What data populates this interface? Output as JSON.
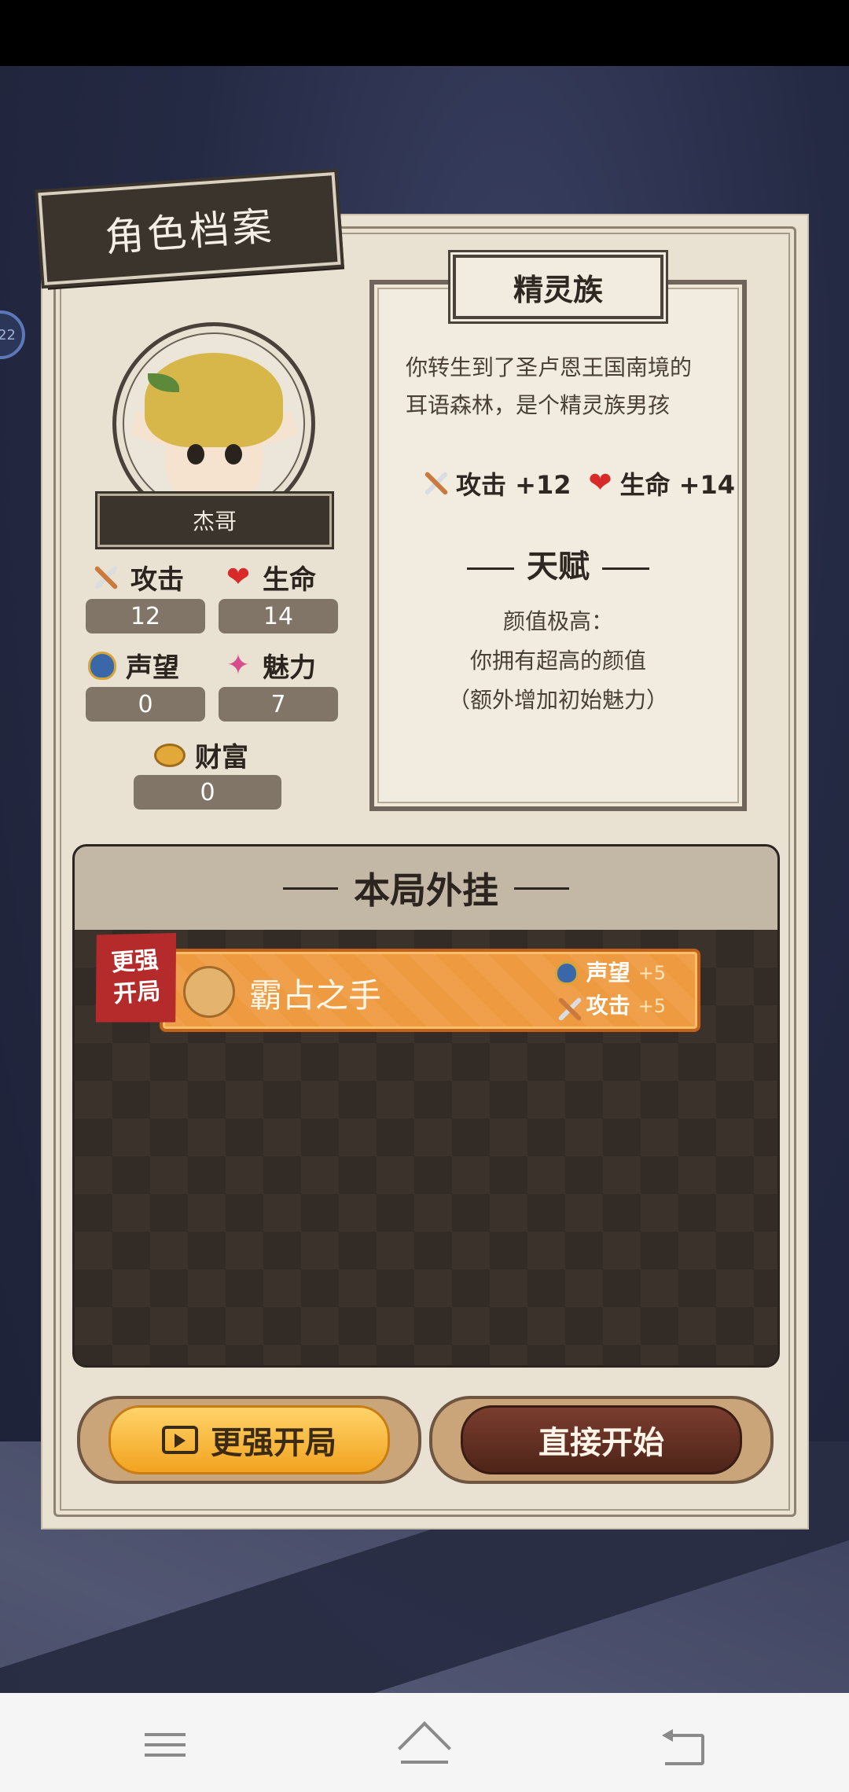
{
  "header": {
    "title": "角色档案"
  },
  "side_bubble": {
    "text": "22"
  },
  "character": {
    "name": "杰哥",
    "stats": {
      "attack": {
        "label": "攻击",
        "value": "12",
        "icon": "crossed-swords-icon"
      },
      "life": {
        "label": "生命",
        "value": "14",
        "icon": "heart-icon"
      },
      "reputation": {
        "label": "声望",
        "value": "0",
        "icon": "badge-icon"
      },
      "charm": {
        "label": "魅力",
        "value": "7",
        "icon": "sparkle-icon"
      },
      "wealth": {
        "label": "财富",
        "value": "0",
        "icon": "coin-icon"
      }
    }
  },
  "race": {
    "name": "精灵族",
    "description_line1": "你转生到了圣卢恩王国南境的",
    "description_line2": "耳语森林，是个精灵族男孩",
    "bonus_attack": "攻击 +12",
    "bonus_life": "生命 +14",
    "talent_title": "天赋",
    "talent_name": "颜值极高：",
    "talent_desc": "你拥有超高的颜值",
    "talent_note": "（额外增加初始魅力）"
  },
  "cheats": {
    "title": "本局外挂",
    "ribbon_line1": "更强",
    "ribbon_line2": "开局",
    "items": [
      {
        "name": "霸占之手",
        "effects": [
          {
            "label": "声望",
            "value": "+5"
          },
          {
            "label": "攻击",
            "value": "+5"
          }
        ]
      }
    ]
  },
  "buttons": {
    "stronger_start": "更强开局",
    "direct_start": "直接开始"
  },
  "colors": {
    "panel_bg": "#e9e1d1",
    "dark_plate": "#3b342d",
    "cheat_orange": "#f0a04a",
    "gold_button": "#f2a31f",
    "brown_button": "#5e2c20"
  }
}
